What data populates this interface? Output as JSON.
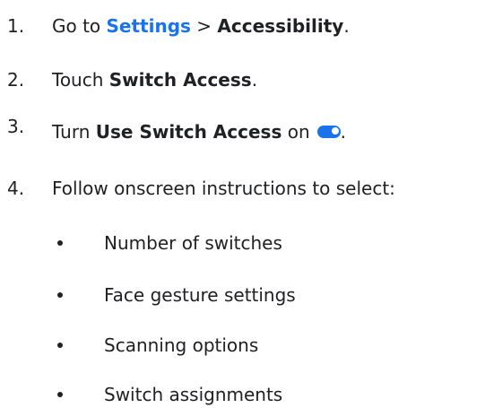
{
  "steps": [
    {
      "number": "1.",
      "text_pre": "Go to",
      "link": "Settings",
      "separator": ">",
      "bold": "Accessibility",
      "text_post": "."
    },
    {
      "number": "2.",
      "text_pre": "Touch",
      "bold": "Switch Access",
      "text_post": "."
    },
    {
      "number": "3.",
      "text_pre": "Turn",
      "bold": "Use Switch Access",
      "text_mid": "on",
      "icon": "toggle-on-icon",
      "text_post": "."
    },
    {
      "number": "4.",
      "text": "Follow onscreen instructions to select:"
    }
  ],
  "sub_items": [
    "Number of switches",
    "Face gesture settings",
    "Scanning options",
    "Switch assignments"
  ],
  "colors": {
    "link": "#1a73e8",
    "text": "#202124",
    "toggle": "#1a73e8"
  }
}
